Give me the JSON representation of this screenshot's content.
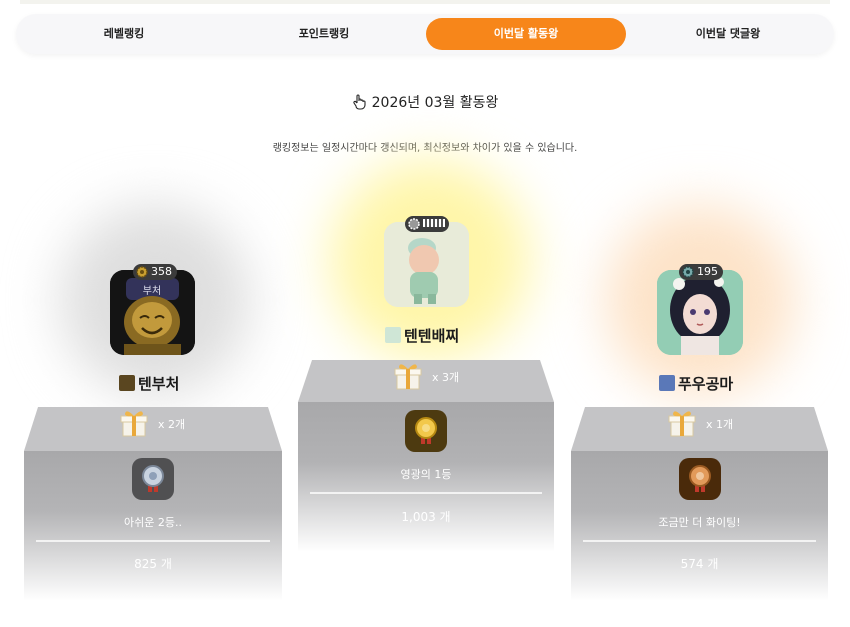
{
  "tabs": [
    {
      "label": "레벨랭킹",
      "active": false
    },
    {
      "label": "포인트랭킹",
      "active": false
    },
    {
      "label": "이번달 활동왕",
      "active": true
    },
    {
      "label": "이번달 댓글왕",
      "active": false
    }
  ],
  "header": {
    "icon": "pointing-hand-icon",
    "title": "2026년 03월 활동왕",
    "notice": "랭킹정보는 일정시간마다 갱신되며, 최신정보와 차이가 있을 수 있습니다."
  },
  "ranks": [
    {
      "rank": 1,
      "level": "",
      "nickname": "텐텐배찌",
      "gift": "x 3개",
      "message": "영광의 1등",
      "count": "1,003 개",
      "medal": "gold",
      "glow_color": "#fff3a0"
    },
    {
      "rank": 2,
      "level": "358",
      "nickname": "텐부처",
      "gift": "x 2개",
      "message": "아쉬운 2등..",
      "count": "825 개",
      "medal": "silver",
      "glow_color": "#dcdcdc"
    },
    {
      "rank": 3,
      "level": "195",
      "nickname": "푸우공마",
      "gift": "x 1개",
      "message": "조금만 더 화이팅!",
      "count": "574 개",
      "medal": "bronze",
      "glow_color": "#fde0c4"
    }
  ],
  "colors": {
    "accent": "#f7861a",
    "podium": "#a9a9ab",
    "podium_top": "#c2c2c4"
  }
}
